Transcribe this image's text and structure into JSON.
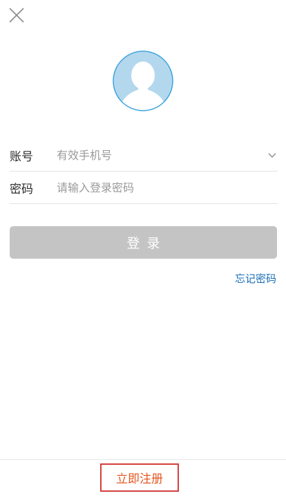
{
  "header": {
    "close_icon": "close-icon"
  },
  "avatar": {
    "icon": "user-avatar-icon",
    "fill_color": "#b3d8ee",
    "stroke_color": "#3da3dd"
  },
  "form": {
    "account": {
      "label": "账号",
      "placeholder": "有效手机号",
      "dropdown_icon": "chevron-down-icon"
    },
    "password": {
      "label": "密码",
      "placeholder": "请输入登录密码"
    }
  },
  "actions": {
    "login_label": "登录",
    "forgot_password_label": "忘记密码",
    "register_label": "立即注册"
  },
  "colors": {
    "login_button_bg": "#c4c4c4",
    "link_blue": "#1a6fb9",
    "register_text": "#e4571f",
    "register_border": "#d43d3d"
  }
}
